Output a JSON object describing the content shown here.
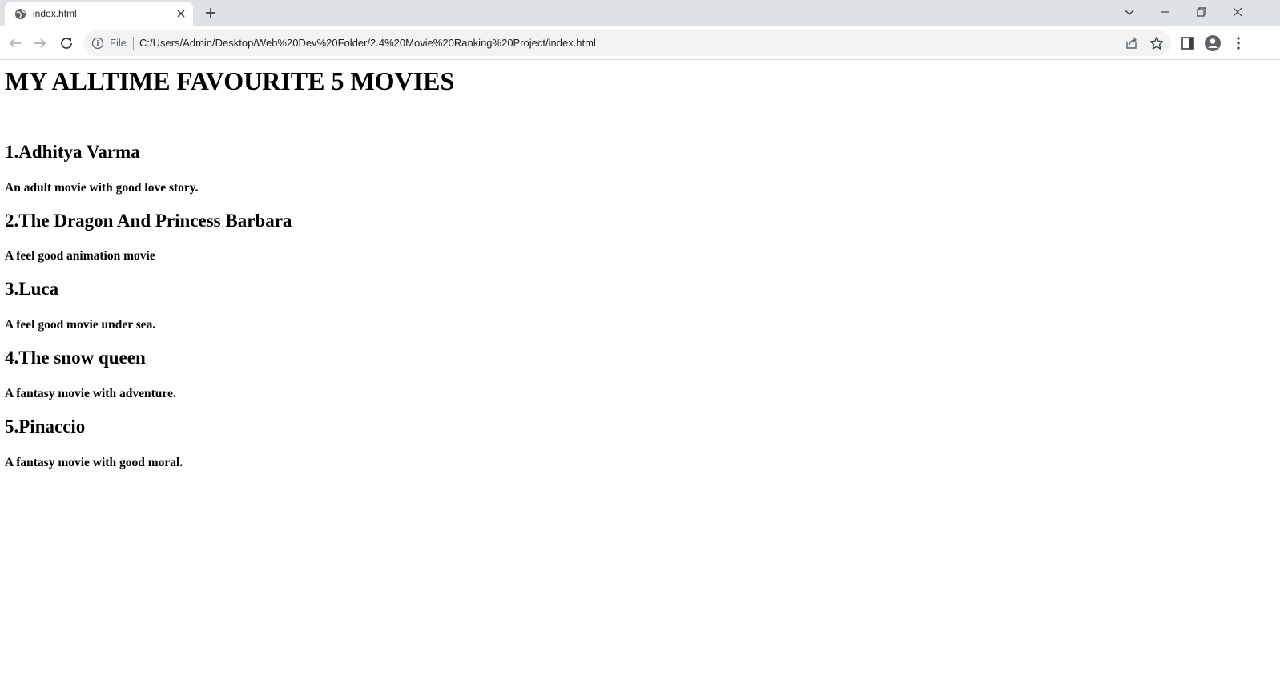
{
  "browser": {
    "tab": {
      "title": "index.html",
      "favicon": "globe-icon",
      "close_icon": "close-icon"
    },
    "new_tab_icon": "plus-icon",
    "window_controls": [
      "chevron-down-icon",
      "minimize-icon",
      "restore-icon",
      "close-icon"
    ],
    "omnibox": {
      "scheme_label": "File",
      "url": "C:/Users/Admin/Desktop/Web%20Dev%20Folder/2.4%20Movie%20Ranking%20Project/index.html"
    }
  },
  "page": {
    "heading": "MY ALLTIME FAVOURITE 5 MOVIES",
    "movies": [
      {
        "title": "1.Adhitya Varma",
        "description": "An adult movie with good love story."
      },
      {
        "title": "2.The Dragon And Princess Barbara",
        "description": "A feel good animation movie"
      },
      {
        "title": "3.Luca",
        "description": "A feel good movie under sea."
      },
      {
        "title": "4.The snow queen",
        "description": "A fantasy movie with adventure."
      },
      {
        "title": "5.Pinaccio",
        "description": "A fantasy movie with good moral."
      }
    ]
  }
}
